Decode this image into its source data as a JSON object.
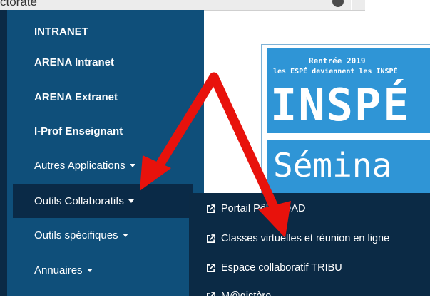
{
  "topbar": {
    "breadcrumb": "ctorate"
  },
  "sidebar": {
    "items": [
      {
        "label": "INTRANET",
        "bold": true
      },
      {
        "label": "ARENA Intranet",
        "bold": true
      },
      {
        "label": "ARENA Extranet",
        "bold": true
      },
      {
        "label": "I-Prof Enseignant",
        "bold": true
      },
      {
        "label": "Autres Applications",
        "bold": false,
        "caret": true
      },
      {
        "label": "Outils Collaboratifs",
        "bold": false,
        "caret": true,
        "active": true
      },
      {
        "label": "Outils spécifiques",
        "bold": false,
        "caret": true
      },
      {
        "label": "Annuaires",
        "bold": false,
        "caret": true
      }
    ]
  },
  "dropdown": {
    "items": [
      {
        "label": "Portail Pôle FOAD",
        "icon": "external-link-icon"
      },
      {
        "label": "Classes virtuelles et réunion en ligne",
        "icon": "external-link-icon"
      },
      {
        "label": "Espace collaboratif TRIBU",
        "icon": "external-link-icon"
      },
      {
        "label": "M@gistère",
        "icon": "external-link-icon"
      }
    ]
  },
  "banner": {
    "line1": "Rentrée 2019",
    "line2": "les ESPÉ deviennent les INSPÉ",
    "big": "INSPÉ",
    "seminar": "Sémina"
  },
  "colors": {
    "sidebar": "#0f4f7a",
    "dropdown": "#0b2a45",
    "banner": "#2f95d6",
    "arrow": "#e8120c"
  }
}
